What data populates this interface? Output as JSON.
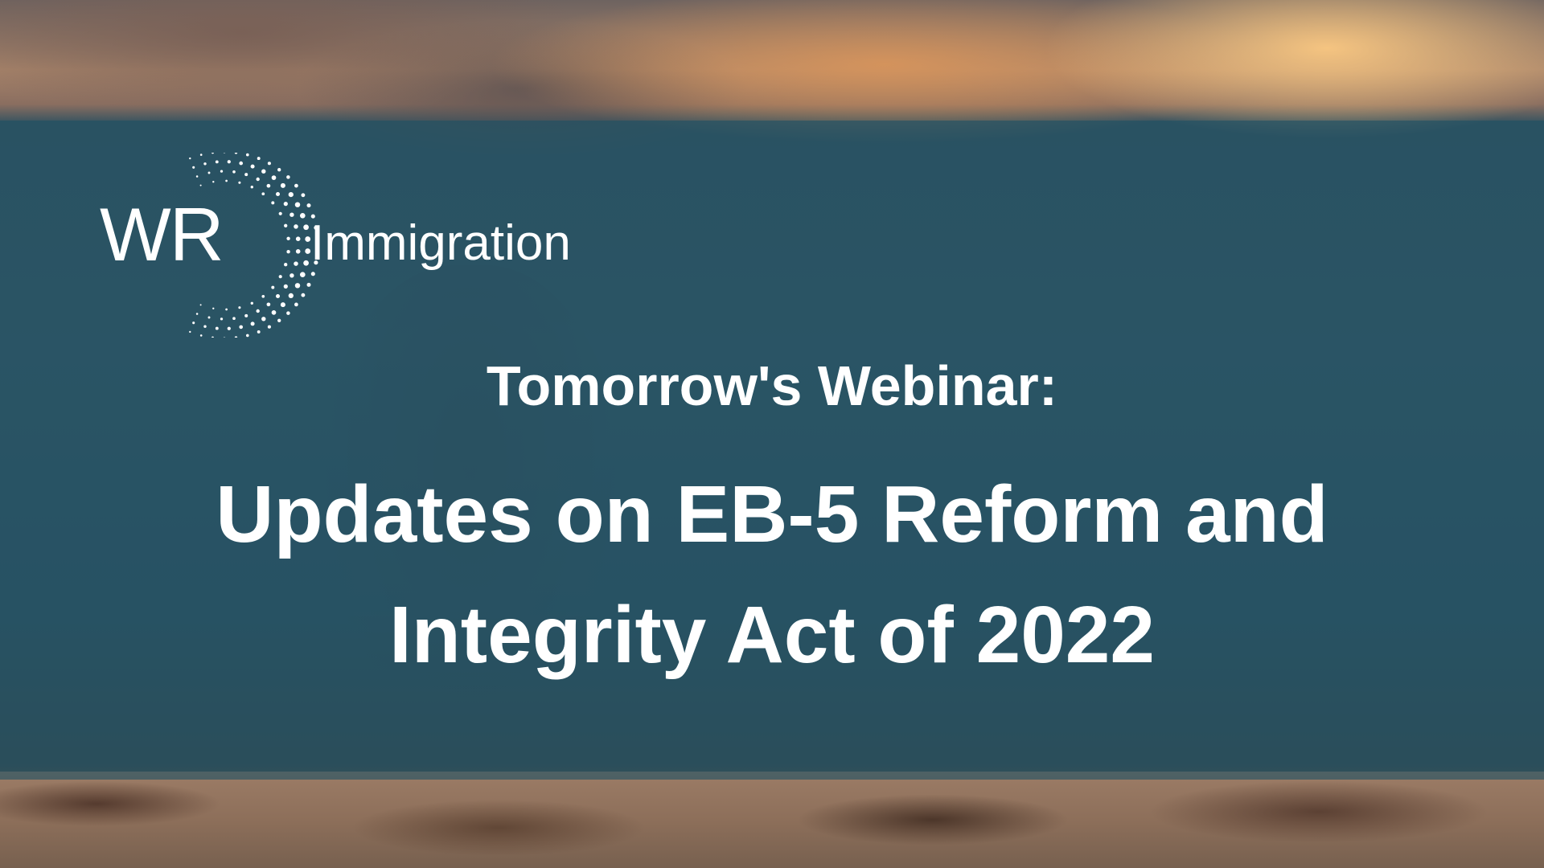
{
  "brand": {
    "logo_mark": "WR",
    "logo_word": "Immigration",
    "logo_icon": "dotted-arc-icon"
  },
  "headline": {
    "eyebrow": "Tomorrow's Webinar:",
    "title_line_1": "Updates on EB-5 Reform and",
    "title_line_2": "Integrity Act of 2022"
  },
  "colors": {
    "band": "#1e5064",
    "text": "#ffffff"
  }
}
